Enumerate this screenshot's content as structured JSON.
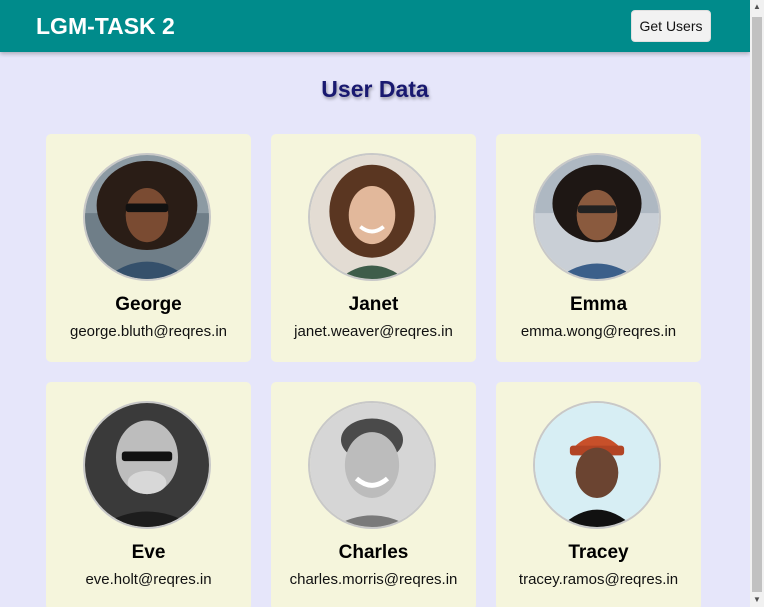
{
  "navbar": {
    "brand": "LGM-TASK 2",
    "button_label": "Get Users"
  },
  "heading": "User Data",
  "users": [
    {
      "name": "George",
      "email": "george.bluth@reqres.in"
    },
    {
      "name": "Janet",
      "email": "janet.weaver@reqres.in"
    },
    {
      "name": "Emma",
      "email": "emma.wong@reqres.in"
    },
    {
      "name": "Eve",
      "email": "eve.holt@reqres.in"
    },
    {
      "name": "Charles",
      "email": "charles.morris@reqres.in"
    },
    {
      "name": "Tracey",
      "email": "tracey.ramos@reqres.in"
    }
  ],
  "colors": {
    "navbar": "#008b8b",
    "background": "#e6e6fa",
    "card": "#f5f5dc",
    "heading": "#191970"
  }
}
